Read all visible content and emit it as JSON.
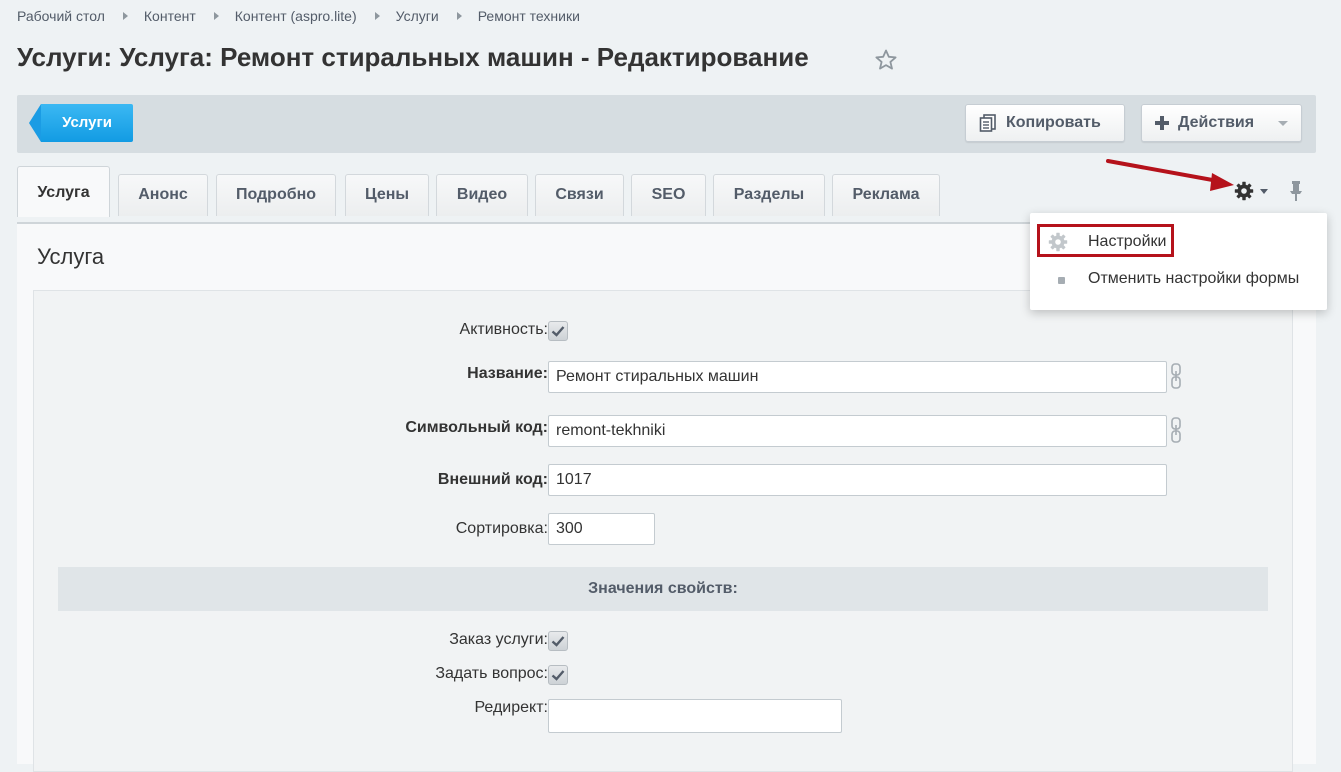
{
  "breadcrumb": [
    "Рабочий стол",
    "Контент",
    "Контент (aspro.lite)",
    "Услуги",
    "Ремонт техники"
  ],
  "page_title": "Услуги: Услуга: Ремонт стиральных машин - Редактирование",
  "toolbar": {
    "back_label": "Услуги",
    "copy_label": "Копировать",
    "actions_label": "Действия"
  },
  "tabs": [
    "Услуга",
    "Анонс",
    "Подробно",
    "Цены",
    "Видео",
    "Связи",
    "SEO",
    "Разделы",
    "Реклама"
  ],
  "settings_menu": {
    "items": [
      "Настройки",
      "Отменить настройки формы"
    ]
  },
  "section_title": "Услуга",
  "form": {
    "active_label": "Активность:",
    "active_checked": true,
    "name_label": "Название:",
    "name_value": "Ремонт стиральных машин",
    "code_label": "Символьный код:",
    "code_value": "remont-tekhniki",
    "ext_code_label": "Внешний код:",
    "ext_code_value": "1017",
    "sort_label": "Сортировка:",
    "sort_value": "300"
  },
  "props": {
    "header": "Значения свойств:",
    "order_label": "Заказ услуги:",
    "order_checked": true,
    "ask_label": "Задать вопрос:",
    "ask_checked": true,
    "redirect_label": "Редирект:",
    "redirect_value": ""
  },
  "colors": {
    "accent": "#1b9ce4",
    "highlight": "#b5121b",
    "background": "#eef2f4"
  }
}
